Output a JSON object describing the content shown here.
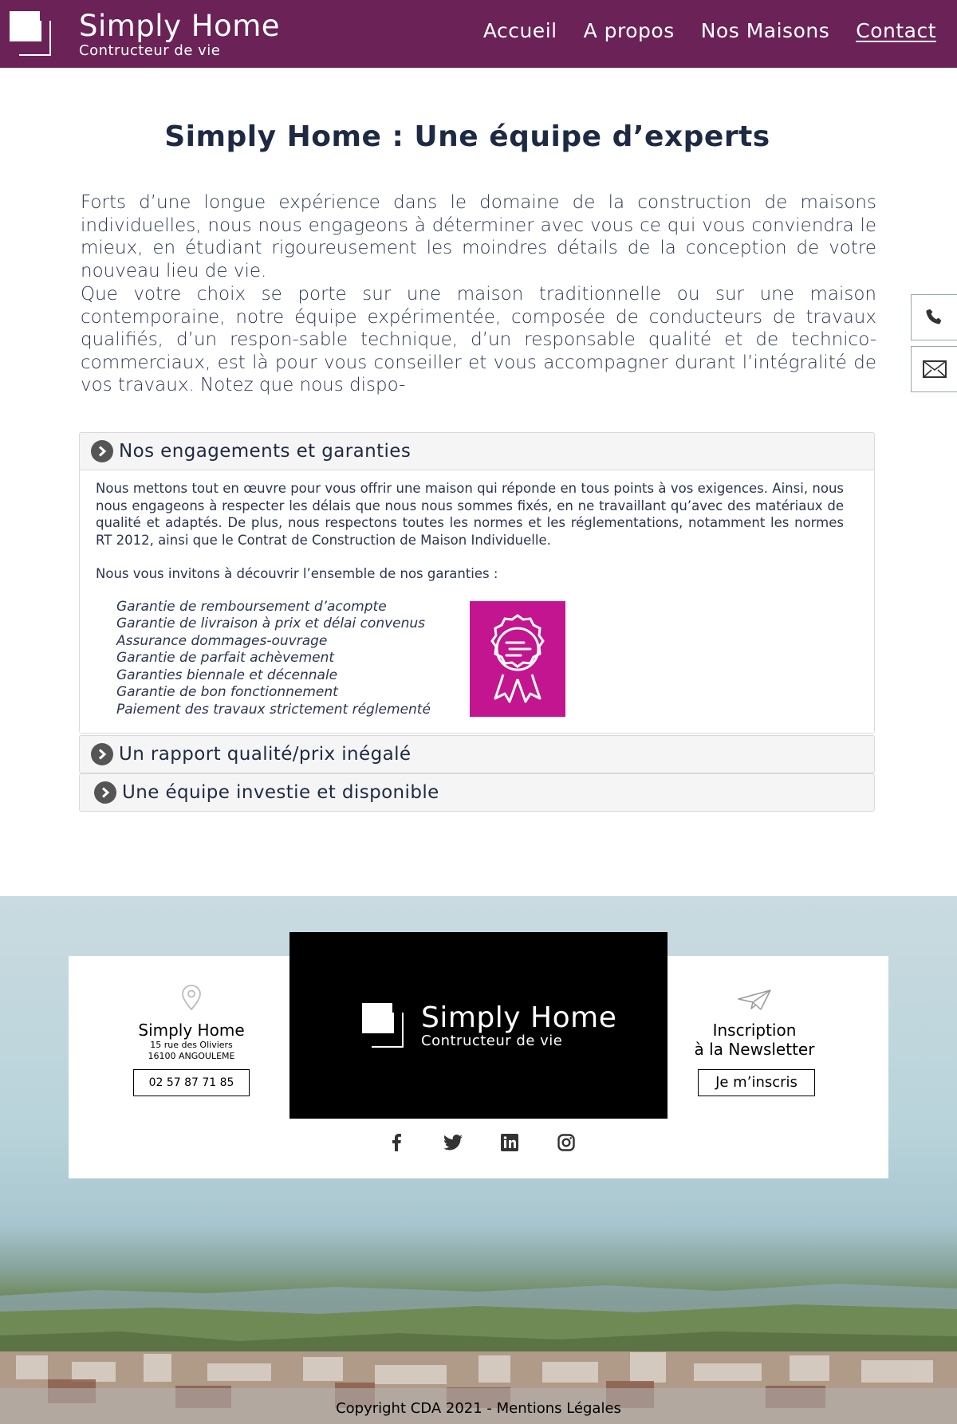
{
  "header": {
    "brand_title": "Simply Home",
    "brand_subtitle": "Contructeur de vie",
    "nav": [
      {
        "label": "Accueil"
      },
      {
        "label": "A propos"
      },
      {
        "label": "Nos Maisons"
      },
      {
        "label": "Contact",
        "active": true
      }
    ]
  },
  "main": {
    "title": "Simply Home : Une équipe d’experts",
    "paragraph1": "Forts d’une longue expérience dans le domaine de la construction de maisons individuelles, nous nous engageons à déterminer avec vous ce qui vous conviendra le mieux, en étudiant rigoureusement les moindres détails de la conception de votre nouveau lieu de vie.",
    "paragraph2": "Que votre choix se porte sur une maison traditionnelle ou sur une maison contemporaine, notre équipe expérimentée, composée de conducteurs de travaux qualifiés, d’un respon-sable technique, d’un responsable qualité et de technico-commerciaux, est là pour vous conseiller et vous accompagner durant l’intégralité de vos travaux. Notez que nous dispo-"
  },
  "accordion": [
    {
      "title": "Nos engagements et garanties",
      "expanded": true,
      "body_p1": "Nous mettons tout en œuvre pour vous offrir une maison qui réponde en tous points à vos exigences. Ainsi, nous nous engageons à respecter les délais que nous nous sommes fixés, en ne travaillant qu’avec des matériaux de qualité et adaptés. De plus, nous respectons toutes les normes et les réglementations, notamment les normes RT 2012, ainsi que le Contrat de Construction de Maison Individuelle.",
      "body_p2": "Nous vous invitons à découvrir l’ensemble de nos garanties :",
      "guarantees": [
        "Garantie de remboursement d’acompte",
        "Garantie de livraison à prix et délai convenus",
        "Assurance dommages-ouvrage",
        "Garantie de parfait achèvement",
        "Garanties biennale et décennale",
        "Garantie de bon fonctionnement",
        "Paiement des travaux strictement réglementé"
      ]
    },
    {
      "title": "Un rapport qualité/prix inégalé",
      "expanded": false
    },
    {
      "title": "Une équipe investie et disponible",
      "expanded": false
    }
  ],
  "footer": {
    "brand_title": "Simply Home",
    "brand_subtitle": "Contructeur de vie",
    "company": "Simply Home",
    "address_line1": "15 rue des Oliviers",
    "address_line2": "16100 ANGOULEME",
    "phone": "02 57 87 71 85",
    "newsletter_line1": "Inscription",
    "newsletter_line2": "à la Newsletter",
    "newsletter_button": "Je m’inscris",
    "socials": [
      "facebook-icon",
      "twitter-icon",
      "linkedin-icon",
      "instagram-icon"
    ],
    "copyright": "Copyright CDA 2021 - Mentions Légales"
  },
  "colors": {
    "header": "#6a2257",
    "badge": "#c2158f",
    "text": "#1e2a44"
  }
}
